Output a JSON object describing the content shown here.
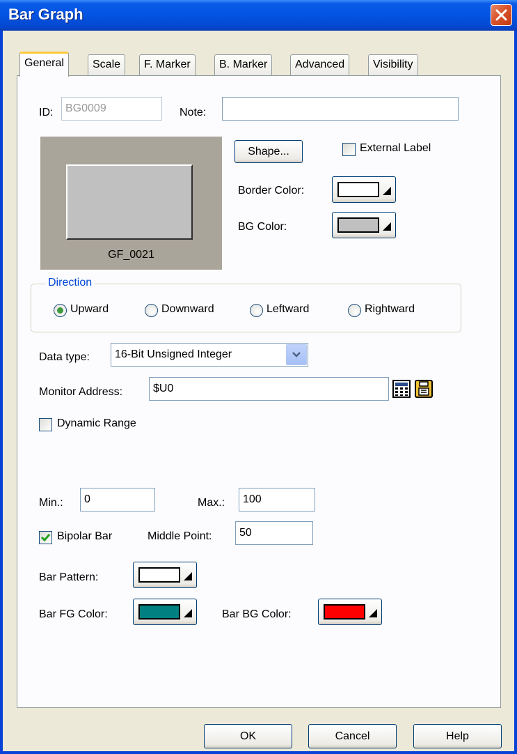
{
  "window": {
    "title": "Bar Graph"
  },
  "tabs": [
    {
      "label": "General"
    },
    {
      "label": "Scale"
    },
    {
      "label": "F. Marker"
    },
    {
      "label": "B. Marker"
    },
    {
      "label": "Advanced"
    },
    {
      "label": "Visibility"
    }
  ],
  "general": {
    "id_label": "ID:",
    "id_value": "BG0009",
    "note_label": "Note:",
    "note_value": "",
    "preview_label": "GF_0021",
    "shape_button": "Shape...",
    "external_label": "External Label",
    "external_label_checked": false,
    "border_color_label": "Border Color:",
    "border_color": "#ffffff",
    "bg_color_label": "BG Color:",
    "bg_color": "#c0c0c0",
    "direction": {
      "legend": "Direction",
      "options": [
        "Upward",
        "Downward",
        "Leftward",
        "Rightward"
      ],
      "selected": "Upward"
    },
    "data_type_label": "Data type:",
    "data_type_value": "16-Bit Unsigned Integer",
    "monitor_address_label": "Monitor Address:",
    "monitor_address_value": "$U0",
    "dynamic_range_label": "Dynamic Range",
    "dynamic_range_checked": false,
    "min_label": "Min.:",
    "min_value": "0",
    "max_label": "Max.:",
    "max_value": "100",
    "bipolar_label": "Bipolar Bar",
    "bipolar_checked": true,
    "middle_point_label": "Middle Point:",
    "middle_point_value": "50",
    "bar_pattern_label": "Bar Pattern:",
    "bar_pattern_color": "#ffffff",
    "bar_fg_label": "Bar FG Color:",
    "bar_fg_color": "#008080",
    "bar_bg_label": "Bar BG Color:",
    "bar_bg_color": "#ff0000"
  },
  "footer": {
    "ok": "OK",
    "cancel": "Cancel",
    "help": "Help"
  },
  "colors": {
    "title_bar": "#0453e2",
    "dialog_bg": "#ece9d8",
    "panel_bg": "#fcfcfe",
    "group_legend": "#0046d5"
  }
}
